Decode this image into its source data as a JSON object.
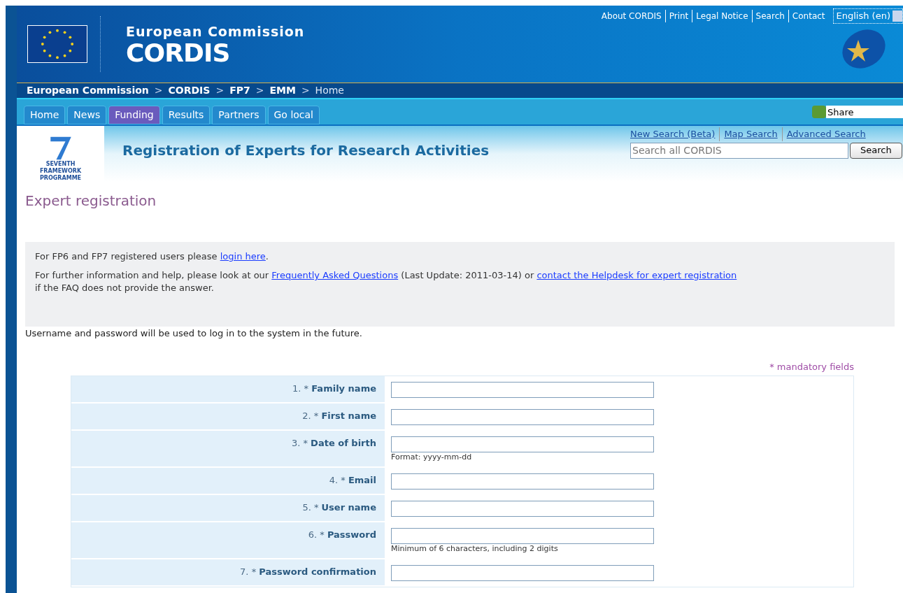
{
  "header": {
    "top_links": [
      "About CORDIS",
      "Print",
      "Legal Notice",
      "Search",
      "Contact"
    ],
    "language": "English (en)",
    "org": "European Commission",
    "site": "CORDIS"
  },
  "breadcrumb": [
    {
      "label": "European Commission",
      "link": true
    },
    {
      "label": "CORDIS",
      "link": true
    },
    {
      "label": "FP7",
      "link": true
    },
    {
      "label": "EMM",
      "link": true
    },
    {
      "label": "Home",
      "link": false
    }
  ],
  "separator": ">",
  "tabs": [
    {
      "label": "Home",
      "selected": false
    },
    {
      "label": "News",
      "selected": false
    },
    {
      "label": "Funding",
      "selected": true
    },
    {
      "label": "Results",
      "selected": false
    },
    {
      "label": "Partners",
      "selected": false
    },
    {
      "label": "Go local",
      "selected": false
    }
  ],
  "share": "Share",
  "banner": {
    "logo_caption": "SEVENTH FRAMEWORK PROGRAMME",
    "title": "Registration of Experts for Research Activities",
    "search_links": [
      "New Search (Beta)",
      "Map Search",
      "Advanced Search"
    ],
    "search_placeholder": "Search all CORDIS",
    "search_button": "Search"
  },
  "page_title": "Expert registration",
  "info": [
    [
      {
        "kind": "text",
        "text": "For FP6 and FP7 registered users please "
      },
      {
        "kind": "link",
        "text": "login here"
      },
      {
        "kind": "text",
        "text": "."
      }
    ],
    [
      {
        "kind": "text",
        "text": "For further information and help, please look at our "
      },
      {
        "kind": "link",
        "text": "Frequently Asked Questions"
      },
      {
        "kind": "text",
        "text": " (Last Update: 2011-03-14) or "
      },
      {
        "kind": "link",
        "text": "contact the Helpdesk for expert registration"
      },
      {
        "kind": "text",
        "text": " if the FAQ does not provide the answer."
      }
    ]
  ],
  "note": "Username and password will be used to log in to the system in the future.",
  "mandatory_note": "* mandatory fields",
  "form": [
    {
      "number": "1.",
      "marker": "*",
      "label": "Family name"
    },
    {
      "number": "2.",
      "marker": "*",
      "label": "First name"
    },
    {
      "number": "3.",
      "marker": "*",
      "label": "Date of birth",
      "hint": "Format: yyyy-mm-dd"
    },
    {
      "number": "4.",
      "marker": "*",
      "label": "Email"
    },
    {
      "number": "5.",
      "marker": "*",
      "label": "User name"
    },
    {
      "number": "6.",
      "marker": "*",
      "label": "Password",
      "hint": "Minimum of 6 characters, including 2 digits"
    },
    {
      "number": "7.",
      "marker": "*",
      "label": "Password confirmation"
    }
  ]
}
